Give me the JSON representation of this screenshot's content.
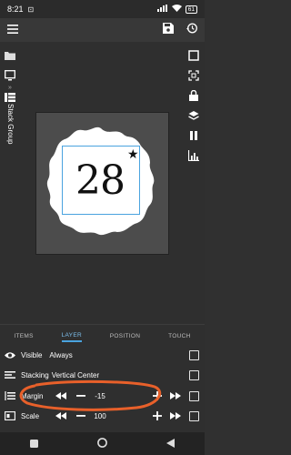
{
  "status_bar": {
    "time": "8:21",
    "battery": "61"
  },
  "sidebar_label": "Stack Group",
  "canvas": {
    "badge_text": "28",
    "star": "★"
  },
  "tabs": [
    {
      "label": "ITEMS",
      "active": false
    },
    {
      "label": "LAYER",
      "active": true
    },
    {
      "label": "POSITION",
      "active": false
    },
    {
      "label": "TOUCH",
      "active": false
    }
  ],
  "properties": {
    "visible": {
      "label": "Visible",
      "value": "Always"
    },
    "stacking": {
      "label": "Stacking",
      "value": "Vertical Center"
    },
    "margin": {
      "label": "Margin",
      "value": "-15"
    },
    "scale": {
      "label": "Scale",
      "value": "100"
    }
  },
  "colors": {
    "accent": "#4aa3df",
    "annotation": "#e8602a",
    "background": "#2f2f2f"
  }
}
